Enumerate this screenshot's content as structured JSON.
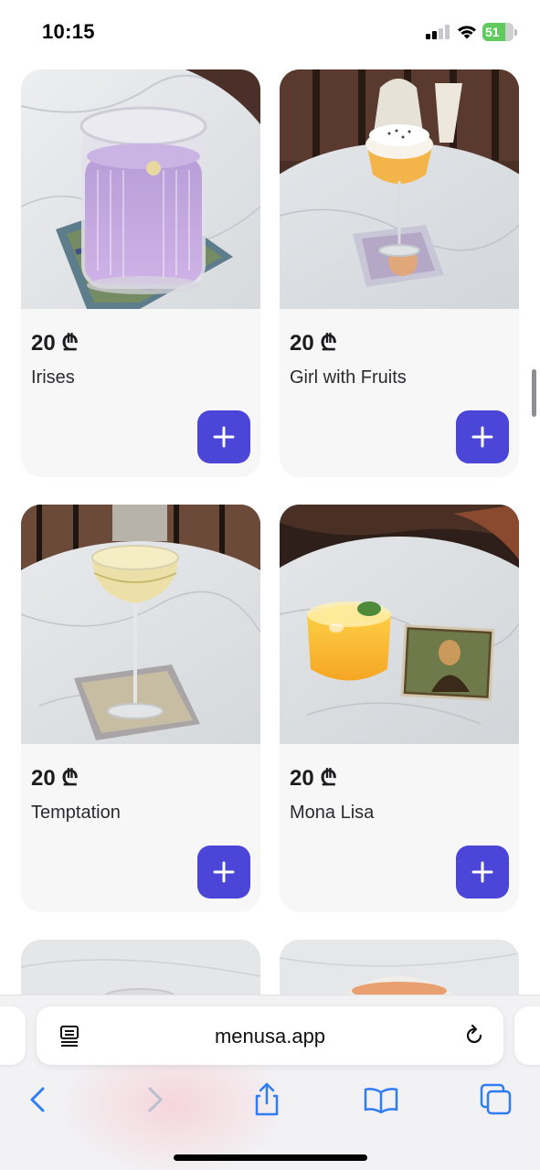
{
  "status_bar": {
    "time": "10:15",
    "battery_level": "51"
  },
  "products": [
    {
      "price": "20 ₾",
      "name": "Irises",
      "photo_icon": "purple-cocktail-photo"
    },
    {
      "price": "20 ₾",
      "name": "Girl with Fruits",
      "photo_icon": "foam-cocktail-photo"
    },
    {
      "price": "20 ₾",
      "name": "Temptation",
      "photo_icon": "coupe-cocktail-photo"
    },
    {
      "price": "20 ₾",
      "name": "Mona Lisa",
      "photo_icon": "orange-cocktail-photo"
    }
  ],
  "add_button_icon": "plus-icon",
  "browser": {
    "url": "menusa.app"
  },
  "colors": {
    "accent": "#4b45d8",
    "card_bg": "#f7f7f8",
    "ios_blue": "#2f7cf6",
    "battery_green": "#5fca5e"
  }
}
